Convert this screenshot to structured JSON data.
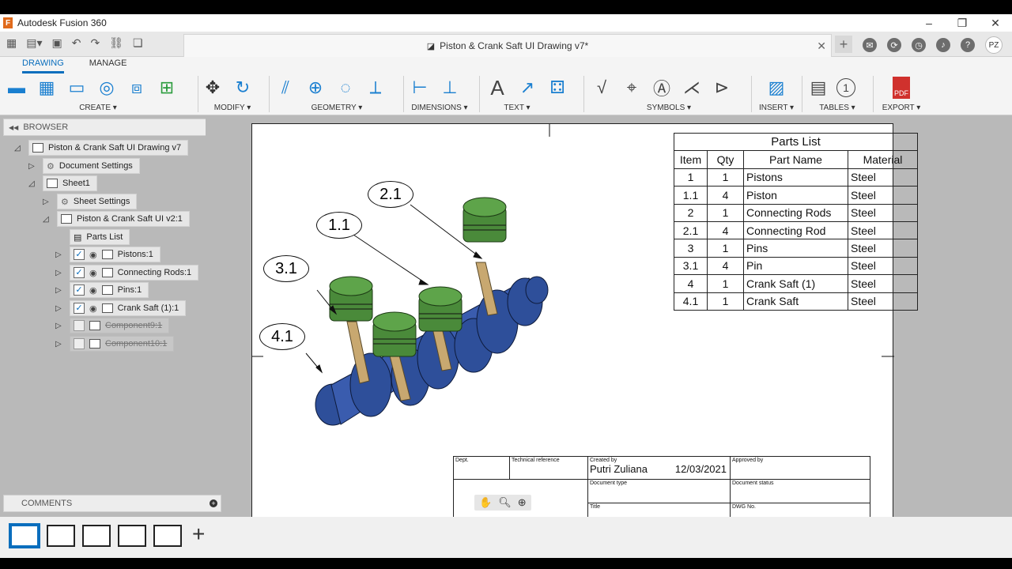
{
  "app": {
    "title": "Autodesk Fusion 360"
  },
  "document": {
    "tab_title": "Piston & Crank Saft UI Drawing v7*"
  },
  "user": {
    "initials": "PZ"
  },
  "ribbon": {
    "tabs": [
      "DRAWING",
      "MANAGE"
    ],
    "groups": {
      "create": "CREATE ▾",
      "modify": "MODIFY ▾",
      "geometry": "GEOMETRY ▾",
      "dimensions": "DIMENSIONS ▾",
      "text": "TEXT ▾",
      "symbols": "SYMBOLS ▾",
      "insert": "INSERT ▾",
      "tables": "TABLES ▾",
      "export": "EXPORT ▾"
    },
    "export_badge": "PDF",
    "text_glyph": "A",
    "balloon_glyph": "1"
  },
  "browser": {
    "header": "BROWSER",
    "tree": {
      "root": "Piston & Crank Saft UI Drawing v7",
      "document_settings": "Document Settings",
      "sheet": "Sheet1",
      "sheet_settings": "Sheet Settings",
      "view": "Piston & Crank Saft UI v2:1",
      "parts_list": "Parts List",
      "components": [
        {
          "label": "Pistons:1",
          "visible": true
        },
        {
          "label": "Connecting Rods:1",
          "visible": true
        },
        {
          "label": "Pins:1",
          "visible": true
        },
        {
          "label": "Crank Saft (1):1",
          "visible": true
        },
        {
          "label": "Component9:1",
          "visible": false
        },
        {
          "label": "Component10:1",
          "visible": false
        }
      ]
    }
  },
  "comments": {
    "header": "COMMENTS"
  },
  "parts_list": {
    "caption": "Parts List",
    "headers": [
      "Item",
      "Qty",
      "Part Name",
      "Material"
    ],
    "rows": [
      [
        "1",
        "1",
        "Pistons",
        "Steel"
      ],
      [
        "1.1",
        "4",
        "Piston",
        "Steel"
      ],
      [
        "2",
        "1",
        "Connecting Rods",
        "Steel"
      ],
      [
        "2.1",
        "4",
        "Connecting Rod",
        "Steel"
      ],
      [
        "3",
        "1",
        "Pins",
        "Steel"
      ],
      [
        "3.1",
        "4",
        "Pin",
        "Steel"
      ],
      [
        "4",
        "1",
        "Crank Saft (1)",
        "Steel"
      ],
      [
        "4.1",
        "1",
        "Crank Saft",
        "Steel"
      ]
    ]
  },
  "balloons": [
    "2.1",
    "1.1",
    "3.1",
    "4.1"
  ],
  "title_block": {
    "dept": "Dept.",
    "technical_reference": "Technical reference",
    "created_by_label": "Created by",
    "created_by": "Putri Zuliana",
    "date": "12/03/2021",
    "approved_by": "Approved by",
    "document_type": "Document type",
    "document_status": "Document status",
    "title": "Title",
    "dwg_no": "DWG No."
  },
  "colors": {
    "accent": "#0a6ebd",
    "piston": "#4a8a3a",
    "crank": "#2e4f9a",
    "rod": "#c8a870"
  }
}
